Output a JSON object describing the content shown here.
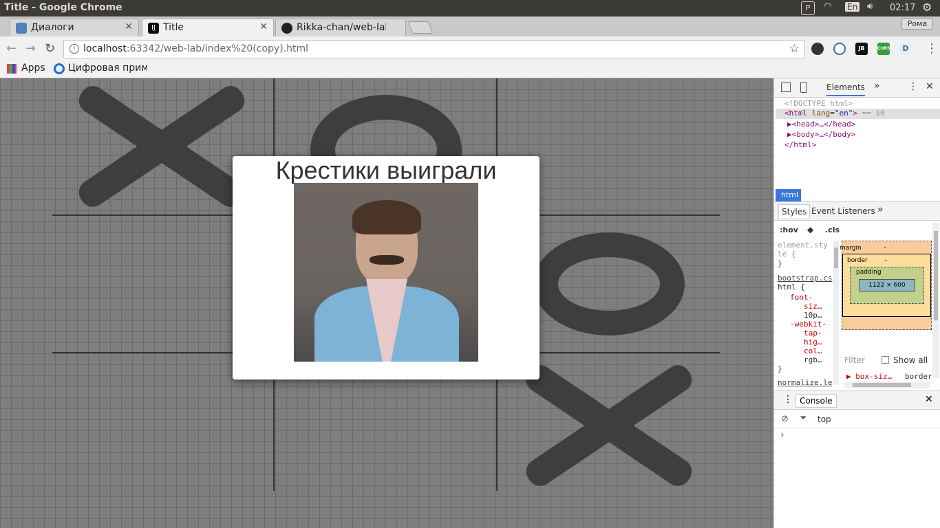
{
  "os": {
    "window_title": "Title - Google Chrome",
    "lang": "En",
    "time": "02:17"
  },
  "tabs": [
    {
      "label": "Диалоги",
      "active": false
    },
    {
      "label": "Title",
      "active": true
    },
    {
      "label": "Rikka-chan/web-lab",
      "active": false
    }
  ],
  "user": "Рома",
  "address": {
    "host": "localhost",
    "rest": ":63342/web-lab/index%20(copy).html"
  },
  "extensions": [
    "JB",
    "CORS"
  ],
  "bookmarks": {
    "apps": "Apps",
    "item": "Цифровая прим"
  },
  "modal": {
    "title": "Крестики выиграли"
  },
  "devtools": {
    "tab_elements": "Elements",
    "dom": {
      "doctype": "<!DOCTYPE html>",
      "html_open": "<html",
      "lang_attr": "lang",
      "lang_val": "\"en\"",
      "close": ">",
      "eq": "== $0",
      "head": "<head>…</head>",
      "body": "<body>…</body>",
      "html_close": "</html>"
    },
    "crumb": "html",
    "subtabs": {
      "styles": "Styles",
      "listeners": "Event Listeners"
    },
    "hov": ":hov",
    "cls": ".cls",
    "rules": {
      "element": "element.sty le {",
      "close": "}",
      "bootstrap": "bootstrap.cs",
      "html_sel": "html {",
      "fs": "font-",
      "siz": "siz…",
      "tenp": "10p…",
      "webkit": "-webkit-",
      "tap": "tap-",
      "hig": "hig…",
      "col": "col…",
      "rgb": "rgb…",
      "normalize": "normalize.le"
    },
    "boxmodel": {
      "margin": "margin",
      "border": "border",
      "padding": "padding",
      "dash": "–",
      "size": "1122 × 600"
    },
    "filter": "Filter",
    "showall": "Show all",
    "prop": "box-siz…",
    "propval": "border",
    "console": {
      "tab": "Console",
      "context": "top",
      "prompt": "›"
    }
  }
}
